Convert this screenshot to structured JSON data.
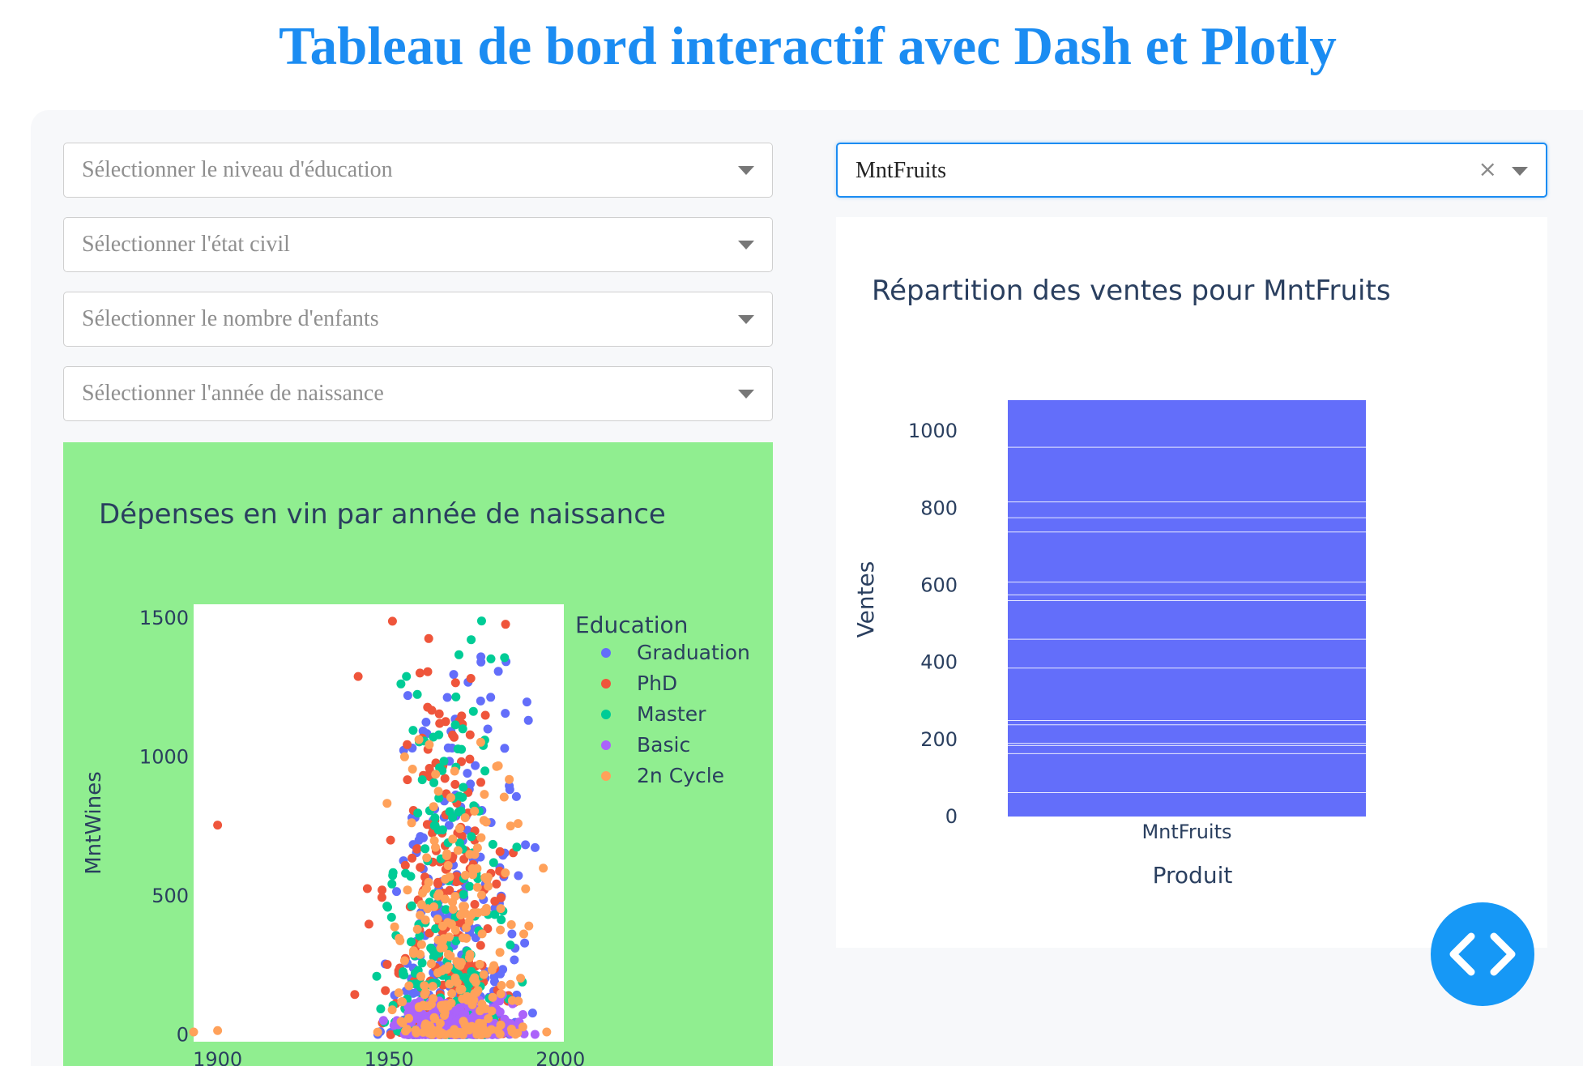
{
  "page": {
    "title": "Tableau de bord interactif avec Dash et Plotly"
  },
  "filters": {
    "education": {
      "placeholder": "Sélectionner le niveau d'éducation"
    },
    "marital": {
      "placeholder": "Sélectionner l'état civil"
    },
    "children": {
      "placeholder": "Sélectionner le nombre d'enfants"
    },
    "birth_year": {
      "placeholder": "Sélectionner l'année de naissance"
    }
  },
  "product_select": {
    "value": "MntFruits",
    "clear_icon": "×"
  },
  "colors": {
    "accent": "#1b8cf2",
    "scatter_bg": "#90ee90",
    "bar": "#636efa",
    "Graduation": "#636efa",
    "PhD": "#ef553b",
    "Master": "#00cc96",
    "Basic": "#ab63fa",
    "2n Cycle": "#ffa15a"
  },
  "icons": {
    "fab": "code-icon",
    "dropdown": "chevron-down-icon",
    "clear": "close-icon"
  },
  "chart_data": [
    {
      "type": "scatter",
      "title": "Dépenses en vin par année de naissance",
      "xlabel": "",
      "ylabel": "MntWines",
      "xlim": [
        1893,
        2001
      ],
      "ylim": [
        -25,
        1550
      ],
      "xticks": [
        1900,
        1950,
        2000
      ],
      "yticks": [
        0,
        500,
        1000,
        1500
      ],
      "grid": false,
      "legend": {
        "title": "Education",
        "position": "right"
      },
      "series": [
        {
          "name": "Graduation",
          "x_range": [
            1943,
            1996
          ],
          "y_range": [
            0,
            1500
          ]
        },
        {
          "name": "PhD",
          "x_range": [
            1940,
            1991
          ],
          "y_range": [
            0,
            1493
          ],
          "extra_points": [
            {
              "x": 1900,
              "y": 755
            },
            {
              "x": 1940,
              "y": 145
            },
            {
              "x": 1941,
              "y": 1290
            },
            {
              "x": 1951,
              "y": 1489
            },
            {
              "x": 1984,
              "y": 1478
            }
          ]
        },
        {
          "name": "Master",
          "x_range": [
            1943,
            1991
          ],
          "y_range": [
            0,
            1492
          ],
          "extra_points": [
            {
              "x": 1977,
              "y": 1490
            }
          ]
        },
        {
          "name": "Basic",
          "x_range": [
            1943,
            1996
          ],
          "y_range": [
            0,
            150
          ]
        },
        {
          "name": "2n Cycle",
          "x_range": [
            1943,
            1996
          ],
          "y_range": [
            0,
            1200
          ],
          "extra_points": [
            {
              "x": 1893,
              "y": 10
            },
            {
              "x": 1900,
              "y": 15
            },
            {
              "x": 1995,
              "y": 600
            },
            {
              "x": 1996,
              "y": 10
            }
          ]
        }
      ]
    },
    {
      "type": "bar",
      "title": "Répartition des ventes pour MntFruits",
      "xlabel": "Produit",
      "ylabel": "Ventes",
      "categories": [
        "MntFruits"
      ],
      "values": [
        1080
      ],
      "ylim": [
        0,
        1080
      ],
      "yticks": [
        0,
        200,
        400,
        600,
        800,
        1000
      ],
      "segment_boundaries": [
        62,
        163,
        184,
        190,
        238,
        249,
        385,
        460,
        560,
        575,
        608,
        738,
        775,
        816,
        958
      ]
    }
  ]
}
